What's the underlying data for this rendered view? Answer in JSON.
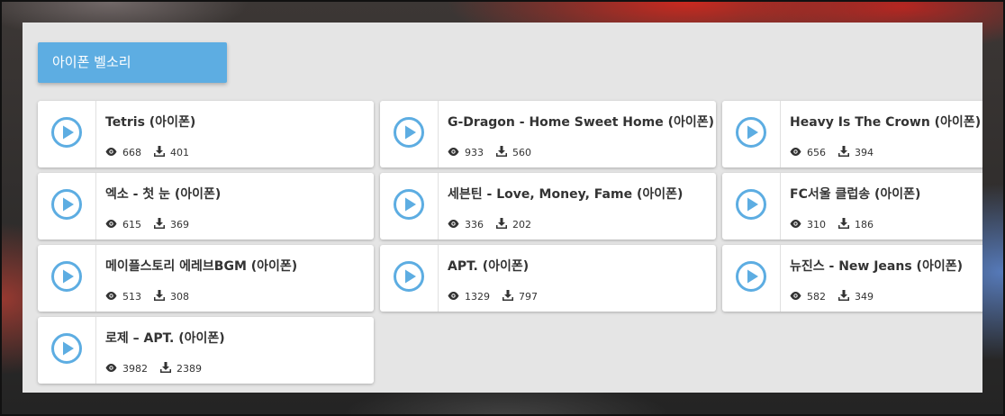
{
  "page": {
    "title": "아이폰 벨소리",
    "accent": "#5dade2"
  },
  "items": [
    {
      "name": "Tetris (아이폰)",
      "views": "668",
      "downloads": "401"
    },
    {
      "name": "G-Dragon - Home Sweet Home (아이폰)",
      "views": "933",
      "downloads": "560"
    },
    {
      "name": "Heavy Is The Crown (아이폰)",
      "views": "656",
      "downloads": "394"
    },
    {
      "name": "엑소 - 첫 눈 (아이폰)",
      "views": "615",
      "downloads": "369"
    },
    {
      "name": "세븐틴 - Love, Money, Fame (아이폰)",
      "views": "336",
      "downloads": "202"
    },
    {
      "name": "FC서울 클럽송 (아이폰)",
      "views": "310",
      "downloads": "186"
    },
    {
      "name": "메이플스토리 에레브BGM (아이폰)",
      "views": "513",
      "downloads": "308"
    },
    {
      "name": "APT. (아이폰)",
      "views": "1329",
      "downloads": "797"
    },
    {
      "name": "뉴진스 - New Jeans (아이폰)",
      "views": "582",
      "downloads": "349"
    },
    {
      "name": "로제 – APT. (아이폰)",
      "views": "3982",
      "downloads": "2389"
    }
  ],
  "icons": {
    "play": "play-circle-icon",
    "views": "eye-icon",
    "downloads": "download-icon"
  }
}
